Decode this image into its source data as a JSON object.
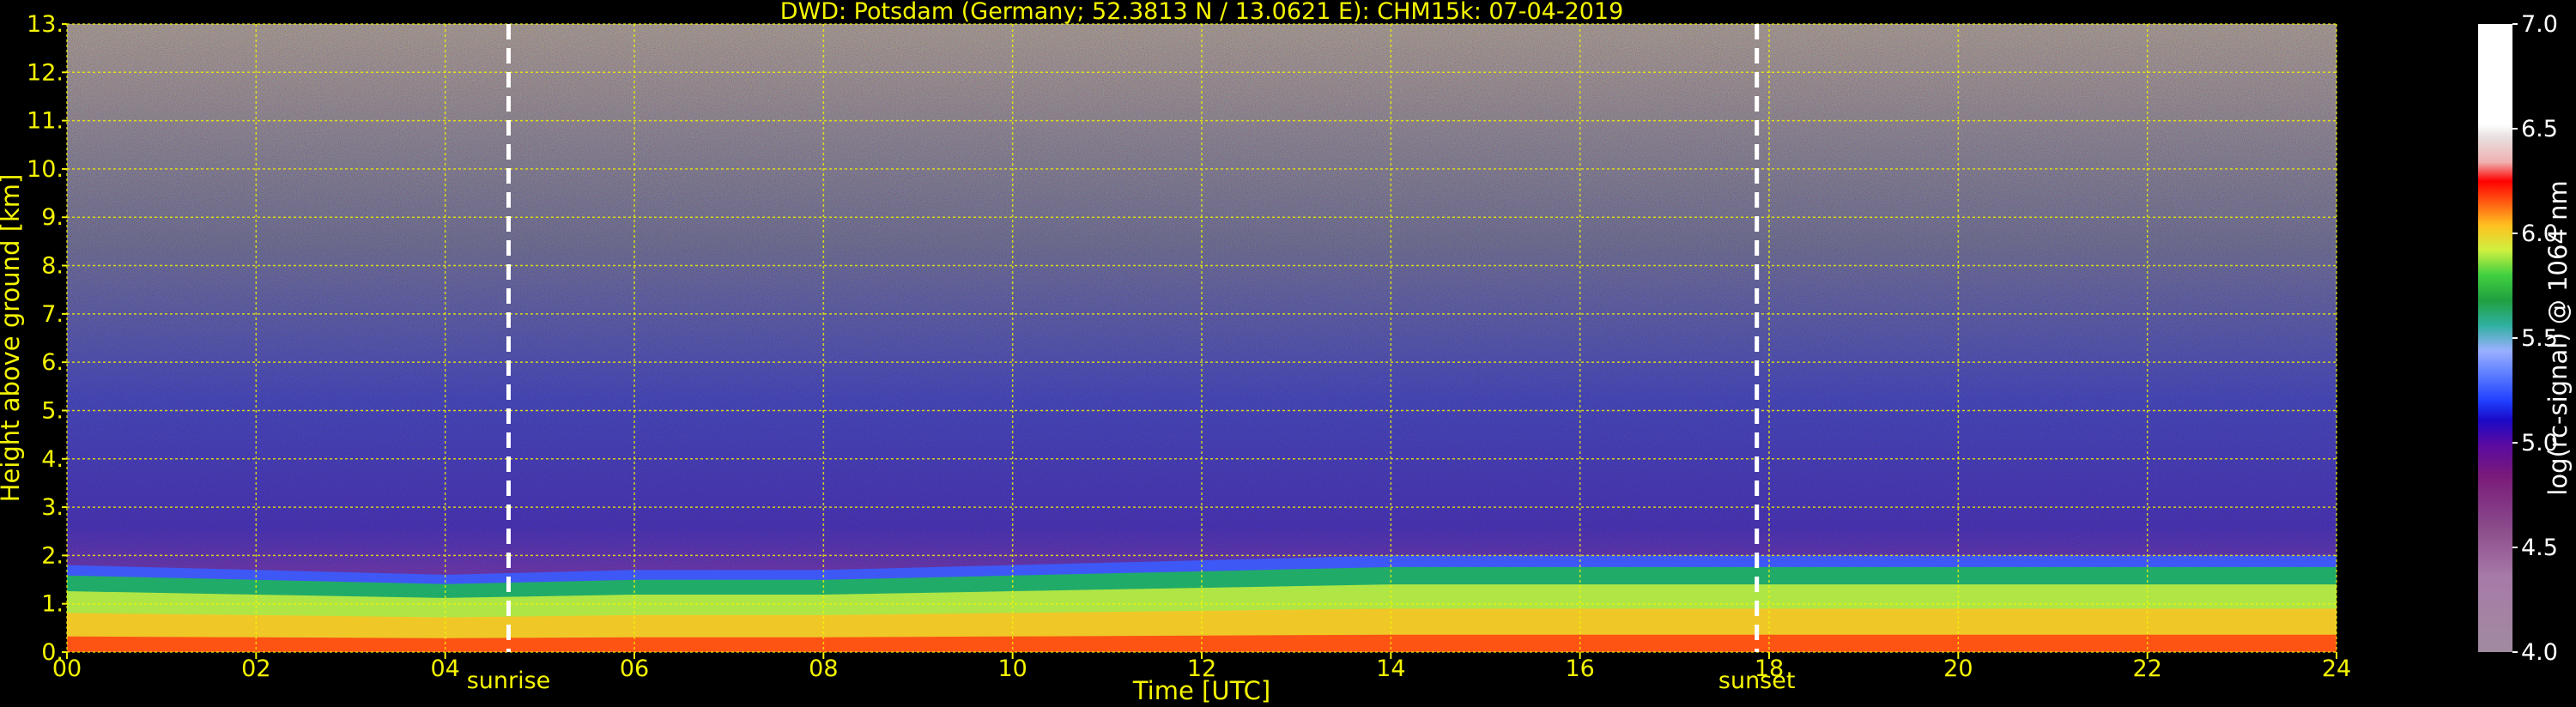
{
  "title": "DWD: Potsdam (Germany; 52.3813 N / 13.0621 E):    CHM15k: 07-04-2019",
  "chart_data": {
    "type": "heatmap",
    "title": "DWD: Potsdam (Germany; 52.3813 N / 13.0621 E):    CHM15k: 07-04-2019",
    "xlabel": "Time [UTC]",
    "ylabel": "Height above ground [km]",
    "xlim": [
      0,
      24
    ],
    "ylim": [
      0,
      13
    ],
    "xticks": [
      0,
      2,
      4,
      6,
      8,
      10,
      12,
      14,
      16,
      18,
      20,
      22,
      24
    ],
    "xtick_labels": [
      "00",
      "02",
      "04",
      "06",
      "08",
      "10",
      "12",
      "14",
      "16",
      "18",
      "20",
      "22",
      "24"
    ],
    "yticks": [
      0,
      1,
      2,
      3,
      4,
      5,
      6,
      7,
      8,
      9,
      10,
      11,
      12,
      13
    ],
    "ytick_labels": [
      "0.",
      "1.",
      "2.",
      "3.",
      "4.",
      "5.",
      "6.",
      "7.",
      "8.",
      "9.",
      "10.",
      "11.",
      "12.",
      "13."
    ],
    "grid": true,
    "grid_color": "#f5f500",
    "event_lines": [
      {
        "label": "sunrise",
        "time": 4.67
      },
      {
        "label": "sunset",
        "time": 17.87
      }
    ],
    "colorbar": {
      "label": "log(rc-signal) @ 1064 nm",
      "range": [
        4.0,
        7.0
      ],
      "ticks": [
        4.0,
        4.5,
        5.0,
        5.5,
        6.0,
        6.5,
        7.0
      ],
      "tick_labels": [
        "4.0",
        "4.5",
        "5.0",
        "5.5",
        "6.0",
        "6.5",
        "7.0"
      ]
    },
    "boundary_layer_top_km": [
      [
        0,
        1.8
      ],
      [
        2,
        1.7
      ],
      [
        4,
        1.6
      ],
      [
        6,
        1.7
      ],
      [
        8,
        1.7
      ],
      [
        10,
        1.8
      ],
      [
        12,
        1.9
      ],
      [
        14,
        2.0
      ],
      [
        16,
        2.0
      ],
      [
        18,
        2.0
      ],
      [
        20,
        2.0
      ],
      [
        22,
        2.0
      ],
      [
        24,
        2.0
      ]
    ]
  },
  "colors": {
    "background": "#000000",
    "text": "#f5f500",
    "event_line": "#ffffff"
  }
}
